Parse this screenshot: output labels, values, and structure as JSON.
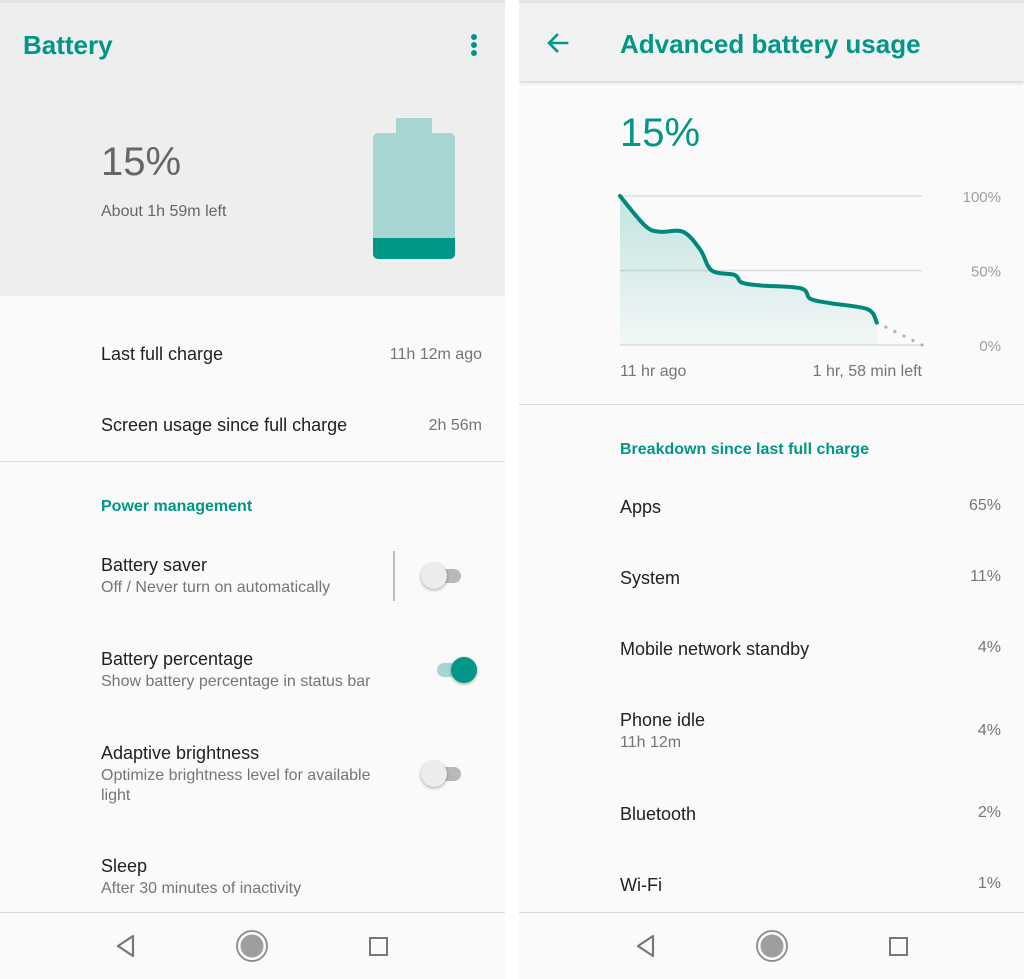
{
  "colors": {
    "accent": "#009688",
    "accent_light": "#a7d5d1",
    "text_primary": "#212121",
    "text_secondary": "#757575"
  },
  "battery_screen": {
    "title": "Battery",
    "overflow_icon": "more-vert-icon",
    "battery_percent": "15%",
    "battery_level": 0.15,
    "time_left": "About 1h 59m left",
    "stats": [
      {
        "label": "Last full charge",
        "value": "11h 12m ago"
      },
      {
        "label": "Screen usage since full charge",
        "value": "2h 56m"
      }
    ],
    "section_header": "Power management",
    "settings": [
      {
        "title": "Battery saver",
        "subtitle": "Off / Never turn on automatically",
        "toggle": false
      },
      {
        "title": "Battery percentage",
        "subtitle": "Show battery percentage in status bar",
        "toggle": true
      },
      {
        "title": "Adaptive brightness",
        "subtitle": "Optimize brightness level for available light",
        "toggle": false
      },
      {
        "title": "Sleep",
        "subtitle": "After 30 minutes of inactivity"
      }
    ]
  },
  "advanced_screen": {
    "title": "Advanced battery usage",
    "back_icon": "arrow-back-icon",
    "battery_percent": "15%",
    "chart_start_label": "11 hr ago",
    "chart_end_label": "1 hr, 58 min left",
    "breakdown_header": "Breakdown since last full charge",
    "breakdown": [
      {
        "label": "Apps",
        "value": "65%"
      },
      {
        "label": "System",
        "value": "11%"
      },
      {
        "label": "Mobile network standby",
        "value": "4%"
      },
      {
        "label": "Phone idle",
        "sublabel": "11h 12m",
        "value": "4%"
      },
      {
        "label": "Bluetooth",
        "value": "2%"
      },
      {
        "label": "Wi-Fi",
        "value": "1%"
      }
    ]
  },
  "navbar": {
    "back": "nav-back-icon",
    "home": "nav-home-icon",
    "recents": "nav-recents-icon"
  },
  "chart_data": {
    "type": "line",
    "title": "",
    "xlabel": "",
    "ylabel": "",
    "x_unit": "hours since last full charge",
    "y_ticks": [
      "100%",
      "50%",
      "0%"
    ],
    "ylim": [
      0,
      100
    ],
    "xlim": [
      0,
      13.17
    ],
    "x_labels": {
      "start": "11 hr ago",
      "end": "1 hr, 58 min left"
    },
    "grid": true,
    "series": [
      {
        "name": "Battery level",
        "style": "solid",
        "x": [
          0,
          1.1,
          1.75,
          2.75,
          3.5,
          4.0,
          5.0,
          5.3,
          6.1,
          7.9,
          8.3,
          9.2,
          10.8,
          11.2
        ],
        "y": [
          100,
          80,
          76,
          76,
          64,
          50,
          47,
          42,
          40,
          38,
          31,
          28,
          24,
          15
        ]
      },
      {
        "name": "Projected",
        "style": "dotted",
        "x": [
          11.2,
          13.17
        ],
        "y": [
          15,
          0
        ]
      }
    ]
  }
}
